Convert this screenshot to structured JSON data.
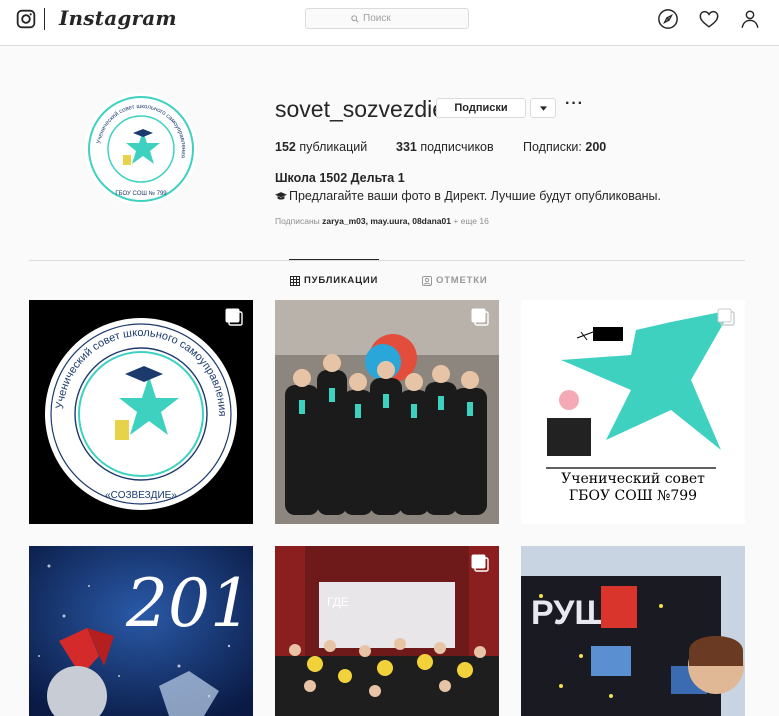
{
  "nav": {
    "wordmark": "Instagram",
    "search_placeholder": "Поиск",
    "icons": [
      "instagram-glyph-icon",
      "compass-icon",
      "heart-icon",
      "person-icon"
    ]
  },
  "profile": {
    "username": "sovet_sozvezdie",
    "following_button": "Подписки",
    "more": "···",
    "stats": {
      "posts_count": "152",
      "posts_label": "публикаций",
      "followers_count": "331",
      "followers_label": "подписчиков",
      "following_label": "Подписки:",
      "following_count": "200"
    },
    "full_name": "Школа 1502 Дельта 1",
    "bio": "Предлагайте ваши фото в Директ. Лучшие будут опубликованы.",
    "followed_by": {
      "prefix": "Подписаны",
      "users": "zarya_m03, may.uura, 08dana01",
      "suffix": "+ еще 16"
    },
    "avatar": {
      "ring_text": "Ученический совет школьного самоуправления",
      "bottom_text": "ГБОУ СОШ № 799"
    }
  },
  "tabs": {
    "posts": "ПУБЛИКАЦИИ",
    "tagged": "ОТМЕТКИ"
  },
  "posts": {
    "p1": {
      "ring_text": "Ученический совет школьного самоуправления",
      "bottom_text": "«СОЗВЕЗДИЕ»"
    },
    "p3": {
      "line1": "Ученический совет",
      "line2": "ГБОУ СОШ №799"
    },
    "p4": {
      "text": "201"
    },
    "p5": {
      "screen_text": "ГДЕ"
    },
    "p6": {
      "letters": "РУШ"
    }
  },
  "colors": {
    "teal": "#3fd1c0",
    "navy": "#1c3a6e",
    "border": "#dbdbdb",
    "muted": "#8e8e8e"
  }
}
